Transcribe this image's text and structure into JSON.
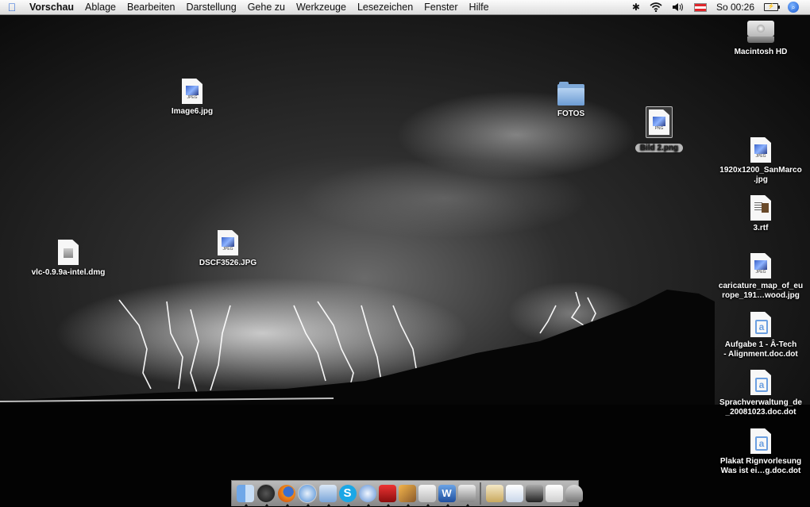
{
  "menubar": {
    "apple_icon": "apple-icon",
    "items": [
      "Vorschau",
      "Ablage",
      "Bearbeiten",
      "Darstellung",
      "Gehe zu",
      "Werkzeuge",
      "Lesezeichen",
      "Fenster",
      "Hilfe"
    ],
    "clock": "So 00:26",
    "status_icons": [
      "bluetooth-icon",
      "wifi-icon",
      "volume-icon",
      "flag-icon",
      "battery-icon",
      "spotlight-icon"
    ]
  },
  "desktop": {
    "icons": {
      "macintosh_hd": "Macintosh HD",
      "image6": "Image6.jpg",
      "fotos": "FOTOS",
      "bild2": "Bild 2.png",
      "sanmarco_1": "1920x1200_SanMarco",
      "sanmarco_2": ".jpg",
      "rtf3": "3.rtf",
      "vlc": "vlc-0.9.9a-intel.dmg",
      "dscf": "DSCF3526.JPG",
      "caricature_1": "caricature_map_of_eu",
      "caricature_2": "rope_191…wood.jpg",
      "aufgabe_1": "Aufgabe 1 - Â-Tech",
      "aufgabe_2": "- Alignment.doc.dot",
      "sprach_1": "Sprachverwaltung_de",
      "sprach_2": "_20081023.doc.dot",
      "plakat_1": "Plakat Rignvorlesung",
      "plakat_2": "Was ist ei…g.doc.dot"
    },
    "file_tags": {
      "jpeg": "JPEG",
      "png": "PNG"
    }
  },
  "dock": {
    "apps": [
      "finder-icon",
      "dashboard-icon",
      "firefox-icon",
      "safari-icon",
      "mail-icon",
      "skype-icon",
      "itunes-icon",
      "photo-booth-icon",
      "iphoto-icon",
      "preview-icon",
      "word-icon",
      "image-capture-icon"
    ],
    "others": [
      "applications-stack-icon",
      "documents-stack-icon",
      "downloads-stack-icon",
      "file-stack-icon",
      "trash-icon"
    ]
  }
}
